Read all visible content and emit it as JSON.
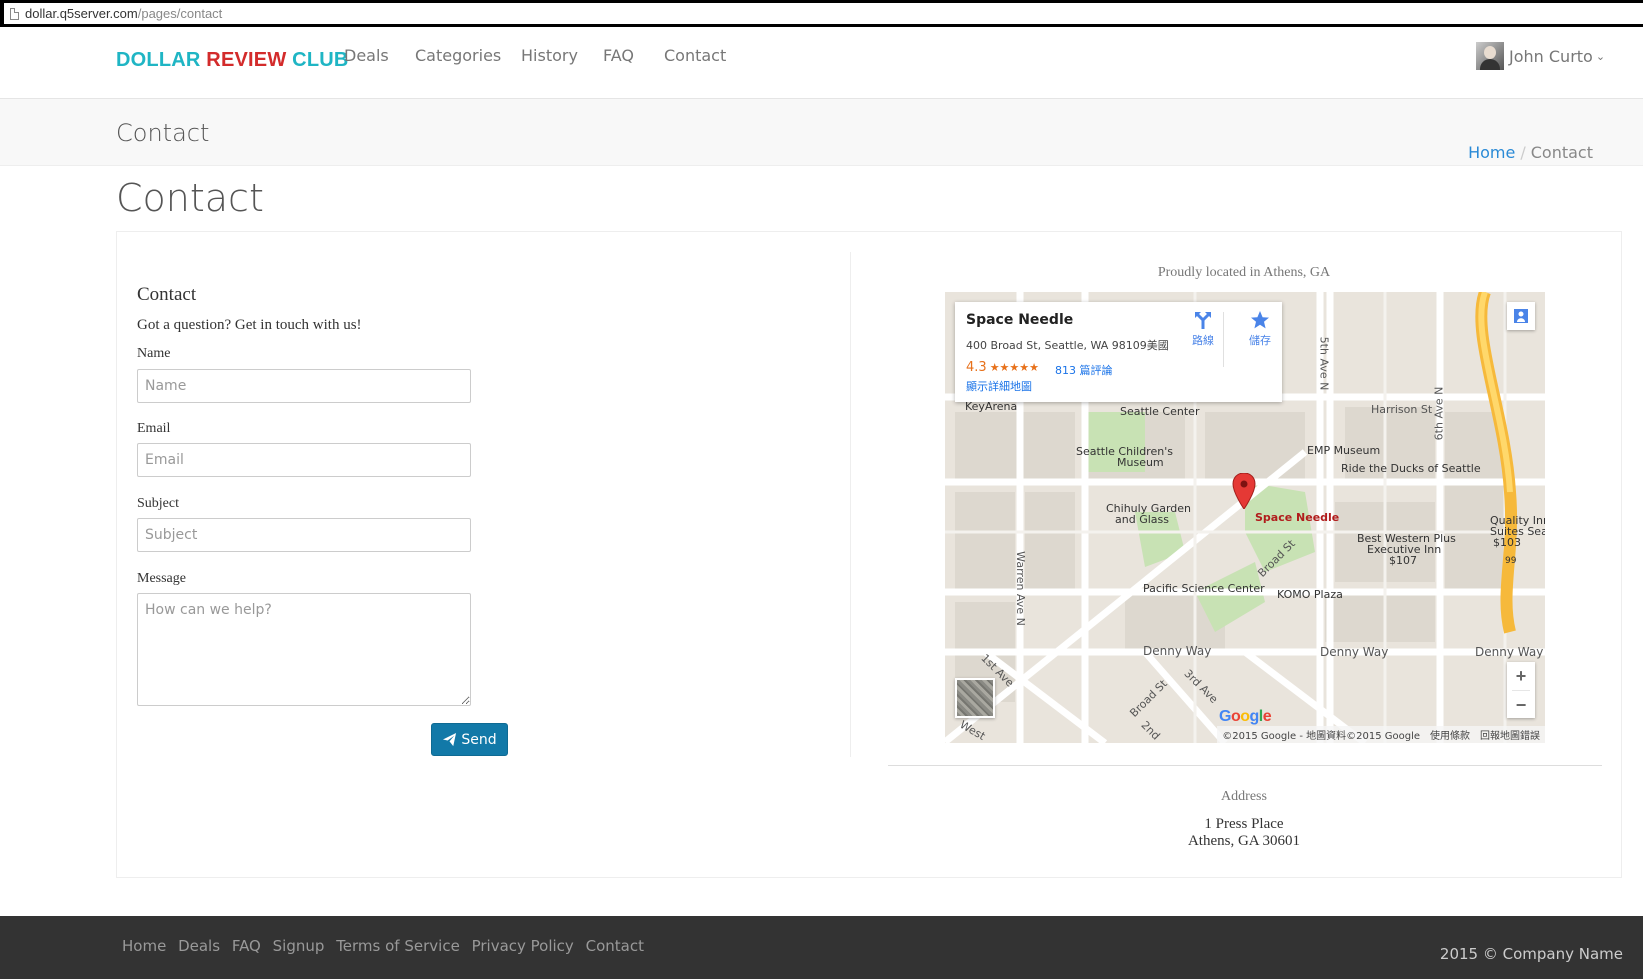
{
  "browser": {
    "url_host": "dollar.q5server.com",
    "url_path": "/pages/contact"
  },
  "navbar": {
    "brand": {
      "part1": "DOLLAR",
      "part2": "REVIEW",
      "part3": "CLUB"
    },
    "links": [
      "Deals",
      "Categories",
      "History",
      "FAQ",
      "Contact"
    ],
    "user_name": "John Curto"
  },
  "band": {
    "title": "Contact",
    "breadcrumb_home": "Home",
    "breadcrumb_sep": "/",
    "breadcrumb_current": "Contact"
  },
  "page_heading": "Contact",
  "form": {
    "title": "Contact",
    "subtitle": "Got a question? Get in touch with us!",
    "name_label": "Name",
    "name_placeholder": "Name",
    "email_label": "Email",
    "email_placeholder": "Email",
    "subject_label": "Subject",
    "subject_placeholder": "Subject",
    "message_label": "Message",
    "message_placeholder": "How can we help?",
    "send_label": "Send"
  },
  "location": {
    "caption": "Proudly located in Athens, GA",
    "address_title": "Address",
    "address_line1": "1 Press Place",
    "address_line2": "Athens, GA 30601"
  },
  "map": {
    "place_name": "Space Needle",
    "place_address": "400 Broad St, Seattle, WA 98109美國",
    "rating": "4.3",
    "stars": "★★★★★",
    "reviews": "813 篇評論",
    "details_link": "顯示詳細地圖",
    "directions_label": "路線",
    "save_label": "儲存",
    "labels": {
      "keyarena": "KeyArena",
      "seattle_center": "Seattle Center",
      "childrens_museum_1": "Seattle Children's",
      "childrens_museum_2": "Museum",
      "emp": "EMP Museum",
      "ducks": "Ride the Ducks of Seattle",
      "harrison": "Harrison St",
      "chihuly_1": "Chihuly Garden",
      "chihuly_2": "and Glass",
      "space_needle": "Space Needle",
      "bw_1": "Best Western Plus",
      "bw_2": "Executive Inn",
      "bw_3": "$107",
      "quality_1": "Quality Inn",
      "quality_2": "Suites Seat",
      "quality_3": "$103",
      "broad_st": "Broad St",
      "pacific": "Pacific Science Center",
      "komo": "KOMO Plaza",
      "denny_1": "Denny Way",
      "denny_2": "Denny Way",
      "denny_3": "Denny Way",
      "fifth_ave": "5th Ave N",
      "sixth_ave": "6th Ave N",
      "warren": "Warren Ave N",
      "first_ave": "1st Ave",
      "broad_st_2": "Broad St",
      "third_ave": "3rd Ave",
      "second": "2nd",
      "west": "West",
      "route99": "99"
    },
    "logo": "Google",
    "attribution": "©2015 Google - 地圖資料©2015 Google",
    "terms": "使用條款",
    "report": "回報地圖錯誤",
    "zoom_in": "+",
    "zoom_out": "−"
  },
  "footer": {
    "links": [
      "Home",
      "Deals",
      "FAQ",
      "Signup",
      "Terms of Service",
      "Privacy Policy",
      "Contact"
    ],
    "copyright": "2015 © Company Name"
  }
}
